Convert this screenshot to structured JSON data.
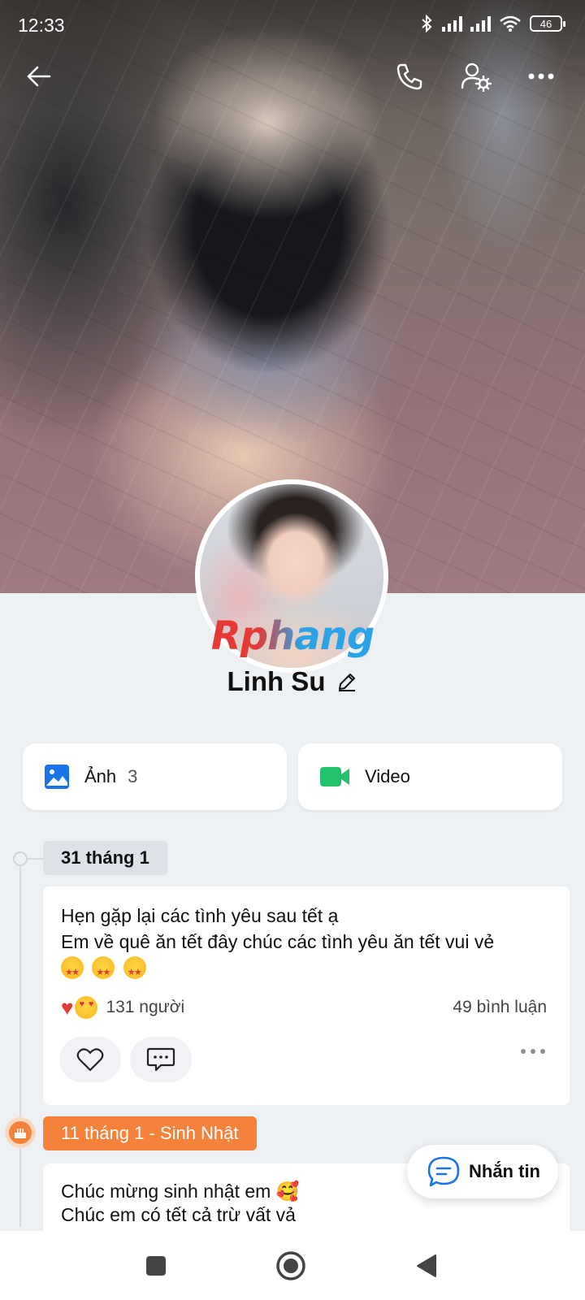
{
  "status_bar": {
    "time": "12:33",
    "battery": "46"
  },
  "profile": {
    "name": "Linh Su",
    "watermark": "Rphang"
  },
  "media": {
    "photos_label": "Ảnh",
    "photos_count": "3",
    "video_label": "Video"
  },
  "timeline": [
    {
      "date": "31 tháng 1",
      "line1": "Hẹn gặp lại các tình yêu sau tết ạ",
      "line2": "Em về quê ăn tết đây chúc các tình yêu ăn tết vui vẻ",
      "reactions_count": "131 người",
      "comments_count": "49 bình luận"
    },
    {
      "date": "11 tháng 1 - Sinh Nhật",
      "line1": "Chúc mừng sinh nhật em 🥰",
      "line2": "Chúc em có tết cả trừ vất vả"
    }
  ],
  "message_button": {
    "label": "Nhắn tin"
  },
  "colors": {
    "accent_orange": "#f5823b",
    "photo_blue": "#1a73e8",
    "video_green": "#25c16f",
    "message_blue": "#1a73e8"
  }
}
